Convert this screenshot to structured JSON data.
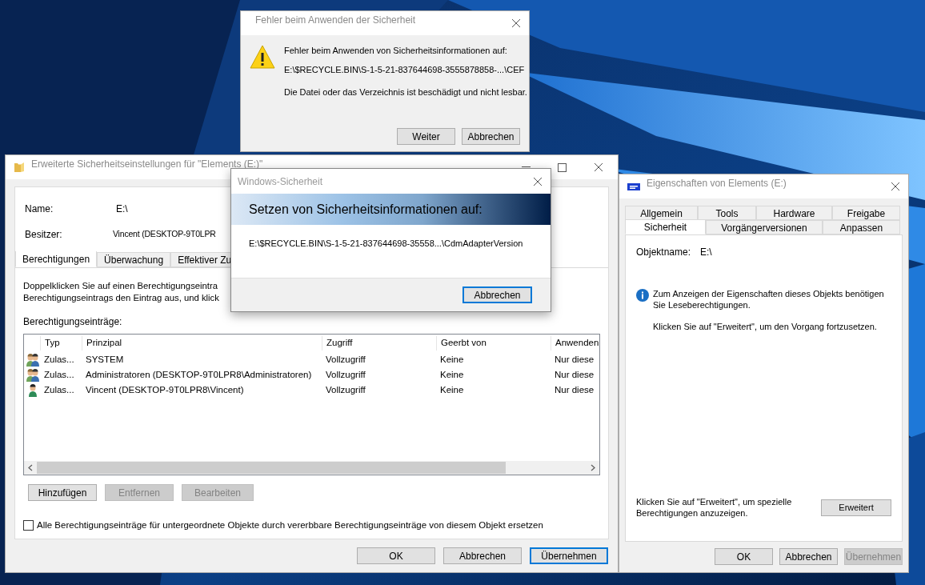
{
  "error_dialog": {
    "title": "Fehler beim Anwenden der Sicherheit",
    "message": "Fehler beim Anwenden von Sicherheitsinformationen auf:",
    "path": "E:\\$RECYCLE.BIN\\S-1-5-21-837644698-3555878858-...\\CEF",
    "detail": "Die Datei oder das Verzeichnis ist beschädigt und nicht lesbar.",
    "buttons": [
      {
        "label": "Weiter",
        "default": false
      },
      {
        "label": "Abbrechen",
        "default": false
      }
    ]
  },
  "security_window": {
    "title": "Erweiterte Sicherheitseinstellungen für \"Elements (E:)\"",
    "name_label": "Name:",
    "name_value": "E:\\",
    "owner_label": "Besitzer:",
    "owner_value": "Vincent (DESKTOP-9T0LPR",
    "tabs": [
      {
        "label": "Berechtigungen",
        "selected": true
      },
      {
        "label": "Überwachung",
        "selected": false
      },
      {
        "label": "Effektiver Zu",
        "selected": false
      }
    ],
    "instructions": [
      "Doppelklicken Sie auf einen Berechtigungseintra",
      "Berechtigungseintrags den Eintrag aus, und klick"
    ],
    "entries_label": "Berechtigungseinträge:",
    "table": {
      "columns": [
        "Typ",
        "Prinzipal",
        "Zugriff",
        "Geerbt von",
        "Anwenden"
      ],
      "rows": [
        {
          "kind": "group",
          "type": "Zulas...",
          "principal": "SYSTEM",
          "access": "Vollzugriff",
          "inherited": "Keine",
          "applies": "Nur diese"
        },
        {
          "kind": "group",
          "type": "Zulas...",
          "principal": "Administratoren (DESKTOP-9T0LPR8\\Administratoren)",
          "access": "Vollzugriff",
          "inherited": "Keine",
          "applies": "Nur diese"
        },
        {
          "kind": "user",
          "type": "Zulas...",
          "principal": "Vincent (DESKTOP-9T0LPR8\\Vincent)",
          "access": "Vollzugriff",
          "inherited": "Keine",
          "applies": "Nur diese"
        }
      ]
    },
    "buttons": [
      {
        "label": "Hinzufügen",
        "disabled": false
      },
      {
        "label": "Entfernen",
        "disabled": true
      },
      {
        "label": "Bearbeiten",
        "disabled": true
      }
    ],
    "replace_checkbox": {
      "label": "Alle Berechtigungseinträge für untergeordnete Objekte durch vererbbare Berechtigungseinträge von diesem Objekt ersetzen",
      "checked": false
    },
    "footer_buttons": [
      {
        "label": "OK",
        "default": false,
        "disabled": false
      },
      {
        "label": "Abbrechen",
        "default": false,
        "disabled": false
      },
      {
        "label": "Übernehmen",
        "default": true,
        "disabled": false
      }
    ]
  },
  "progress_dialog": {
    "title": "Windows-Sicherheit",
    "heading": "Setzen von Sicherheitsinformationen auf:",
    "path": "E:\\$RECYCLE.BIN\\S-1-5-21-837644698-35558...\\CdmAdapterVersion",
    "buttons": [
      {
        "label": "Abbrechen",
        "default": true
      }
    ]
  },
  "properties_window": {
    "title": "Eigenschaften von Elements (E:)",
    "tab_rows": [
      [
        {
          "label": "Allgemein",
          "selected": false
        },
        {
          "label": "Tools",
          "selected": false
        },
        {
          "label": "Hardware",
          "selected": false
        },
        {
          "label": "Freigabe",
          "selected": false
        }
      ],
      [
        {
          "label": "Sicherheit",
          "selected": true
        },
        {
          "label": "Vorgängerversionen",
          "selected": false
        },
        {
          "label": "Anpassen",
          "selected": false
        }
      ]
    ],
    "object_label": "Objektname:",
    "object_value": "E:\\",
    "info": "Zum Anzeigen der Eigenschaften dieses Objekts benötigen Sie Leseberechtigungen.",
    "continue_hint": "Klicken Sie auf \"Erweitert\", um den Vorgang fortzusetzen.",
    "advanced_hint": "Klicken Sie auf \"Erweitert\", um spezielle Berechtigungen anzuzeigen.",
    "advanced_button": "Erweitert",
    "footer_buttons": [
      {
        "label": "OK",
        "default": false,
        "disabled": false
      },
      {
        "label": "Abbrechen",
        "default": false,
        "disabled": false
      },
      {
        "label": "Übernehmen",
        "default": false,
        "disabled": true
      }
    ]
  }
}
